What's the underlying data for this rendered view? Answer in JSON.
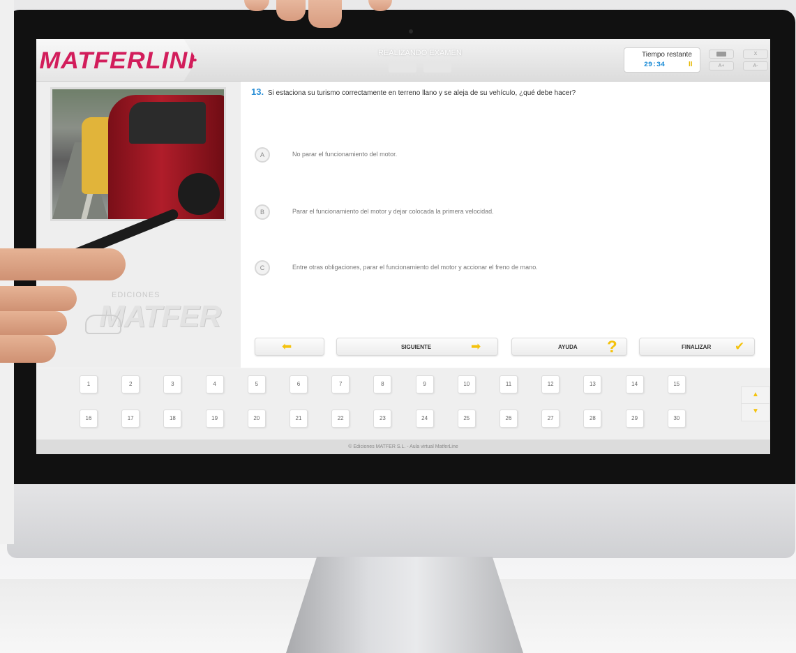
{
  "app": {
    "logo_text": "MATFERLINE",
    "exam_title": "REALIZANDO EXAMEN"
  },
  "timer": {
    "label": "Tiempo restante",
    "value": "29:34",
    "pause_symbol": "II"
  },
  "top_buttons": {
    "close": "X",
    "font_increase": "A+",
    "font_decrease": "A-"
  },
  "question": {
    "number": "13.",
    "text": "Si estaciona su turismo correctamente en terreno llano y se aleja de su vehículo, ¿qué debe hacer?"
  },
  "answers": [
    {
      "letter": "A",
      "text": "No parar el funcionamiento del motor."
    },
    {
      "letter": "B",
      "text": "Parar el funcionamiento del motor y dejar colocada la primera velocidad."
    },
    {
      "letter": "C",
      "text": "Entre otras obligaciones, parar el funcionamiento del motor y accionar el freno de mano."
    }
  ],
  "actions": {
    "next": "SIGUIENTE",
    "help": "AYUDA",
    "finish": "FINALIZAR"
  },
  "watermark": {
    "small": "EDICIONES",
    "big": "MATFER"
  },
  "question_numbers_row1": [
    "1",
    "2",
    "3",
    "4",
    "5",
    "6",
    "7",
    "8",
    "9",
    "10",
    "11",
    "12",
    "13",
    "14",
    "15"
  ],
  "question_numbers_row2": [
    "16",
    "17",
    "18",
    "19",
    "20",
    "21",
    "22",
    "23",
    "24",
    "25",
    "26",
    "27",
    "28",
    "29",
    "30"
  ],
  "footer": "© Ediciones MATFER S.L. - Aula virtual MatferLine",
  "colors": {
    "brand": "#d21d5b",
    "accent_blue": "#2b8fd6",
    "accent_yellow": "#f4c20d"
  },
  "icons": {
    "back": "arrow-left-icon",
    "next": "arrow-right-icon",
    "help": "question-mark-icon",
    "finish": "checkmark-icon",
    "pause": "pause-icon",
    "scroll_up": "chevron-up-icon",
    "scroll_down": "chevron-down-icon"
  }
}
